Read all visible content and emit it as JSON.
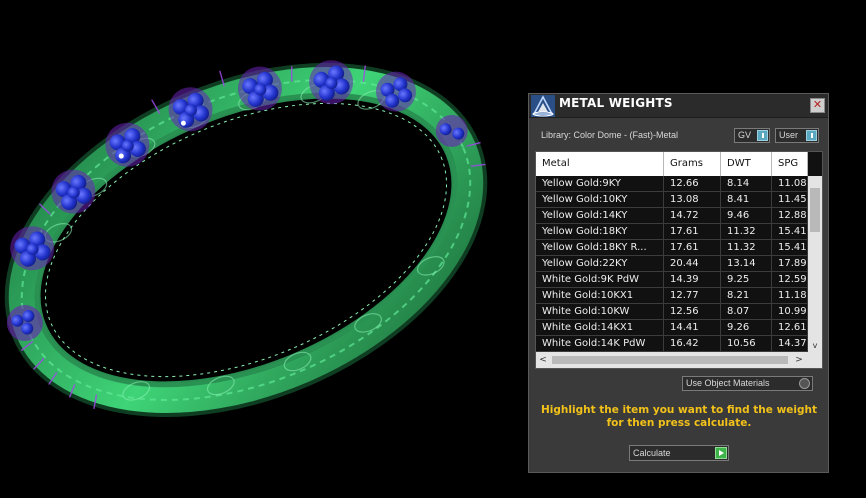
{
  "panel": {
    "title": "METAL WEIGHTS",
    "close_glyph": "✕",
    "library_label": "Library: Color Dome - (Fast)-Metal",
    "toggles": {
      "gv": "GV",
      "user": "User"
    },
    "table": {
      "columns": [
        "Metal",
        "Grams",
        "DWT",
        "SPG"
      ],
      "rows": [
        [
          "Yellow Gold:9KY",
          "12.66",
          "8.14",
          "11.08"
        ],
        [
          "Yellow Gold:10KY",
          "13.08",
          "8.41",
          "11.45"
        ],
        [
          "Yellow Gold:14KY",
          "14.72",
          "9.46",
          "12.88"
        ],
        [
          "Yellow Gold:18KY",
          "17.61",
          "11.32",
          "15.41"
        ],
        [
          "Yellow Gold:18KY R...",
          "17.61",
          "11.32",
          "15.41"
        ],
        [
          "Yellow Gold:22KY",
          "20.44",
          "13.14",
          "17.89"
        ],
        [
          "White Gold:9K PdW",
          "14.39",
          "9.25",
          "12.59"
        ],
        [
          "White Gold:10KX1",
          "12.77",
          "8.21",
          "11.18"
        ],
        [
          "White Gold:10KW",
          "12.56",
          "8.07",
          "10.99"
        ],
        [
          "White Gold:14KX1",
          "14.41",
          "9.26",
          "12.61"
        ],
        [
          "White Gold:14K PdW",
          "16.42",
          "10.56",
          "14.37"
        ]
      ],
      "scroll_glyphs": {
        "left": "<",
        "right": ">",
        "down": "v"
      }
    },
    "use_object_materials_label": "Use Object Materials",
    "instructions": "Highlight the item you want to find the weight for then press calculate.",
    "calculate_label": "Calculate"
  },
  "colors": {
    "panel_bg": "#3a3a3a",
    "instruction_text": "#f2c21a",
    "ring_green": "#3ec86a",
    "gem_blue": "#2a3fd6",
    "prong_purple": "#8a3cd8"
  },
  "icons": [
    "app-logo-icon",
    "close-icon",
    "toggle-knob-icon",
    "radio-icon",
    "arrow-right-icon"
  ]
}
